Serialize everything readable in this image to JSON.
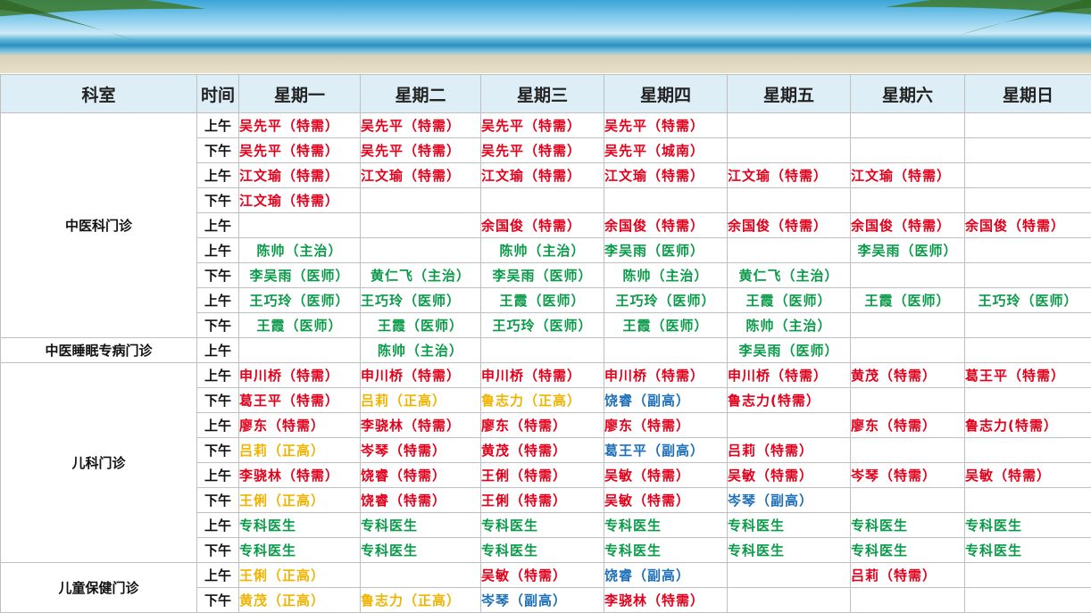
{
  "header": {
    "dept": "科室",
    "time": "时间",
    "days": [
      "星期一",
      "星期二",
      "星期三",
      "星期四",
      "星期五",
      "星期六",
      "星期日"
    ]
  },
  "groups": [
    {
      "dept": "中医科门诊",
      "rows": [
        {
          "time": "上午",
          "cells": [
            {
              "t": "吴先平（特需）",
              "c": "red"
            },
            {
              "t": "吴先平（特需）",
              "c": "red"
            },
            {
              "t": "吴先平（特需）",
              "c": "red"
            },
            {
              "t": "吴先平（特需）",
              "c": "red"
            },
            null,
            null,
            null
          ]
        },
        {
          "time": "下午",
          "cells": [
            {
              "t": "吴先平（特需）",
              "c": "red"
            },
            {
              "t": "吴先平（特需）",
              "c": "red"
            },
            {
              "t": "吴先平（特需）",
              "c": "red"
            },
            {
              "t": "吴先平（城南）",
              "c": "red"
            },
            null,
            null,
            null
          ]
        },
        {
          "time": "上午",
          "cells": [
            {
              "t": "江文瑜（特需）",
              "c": "red"
            },
            {
              "t": "江文瑜（特需）",
              "c": "red"
            },
            {
              "t": "江文瑜（特需）",
              "c": "red"
            },
            {
              "t": "江文瑜（特需）",
              "c": "red"
            },
            {
              "t": "江文瑜（特需）",
              "c": "red"
            },
            {
              "t": "江文瑜（特需）",
              "c": "red"
            },
            null
          ]
        },
        {
          "time": "下午",
          "cells": [
            {
              "t": "江文瑜（特需）",
              "c": "red"
            },
            null,
            null,
            null,
            null,
            null,
            null
          ]
        },
        {
          "time": "上午",
          "cells": [
            null,
            null,
            {
              "t": "余国俊（特需）",
              "c": "red"
            },
            {
              "t": "余国俊（特需）",
              "c": "red"
            },
            {
              "t": "余国俊（特需）",
              "c": "red"
            },
            {
              "t": "余国俊（特需）",
              "c": "red"
            },
            {
              "t": "余国俊（特需）",
              "c": "red"
            }
          ]
        },
        {
          "time": "上午",
          "cells": [
            {
              "t": "陈帅（主治）",
              "c": "green",
              "center": true
            },
            null,
            {
              "t": "陈帅（主治）",
              "c": "green",
              "center": true
            },
            {
              "t": "李吴雨（医师）",
              "c": "green"
            },
            null,
            {
              "t": "李吴雨（医师）",
              "c": "green",
              "center": true
            },
            null
          ]
        },
        {
          "time": "下午",
          "cells": [
            {
              "t": "李吴雨（医师）",
              "c": "green",
              "center": true
            },
            {
              "t": "黄仁飞（主治）",
              "c": "green",
              "center": true
            },
            {
              "t": "李吴雨（医师）",
              "c": "green",
              "center": true
            },
            {
              "t": "陈帅（主治）",
              "c": "green",
              "center": true
            },
            {
              "t": "黄仁飞（主治）",
              "c": "green",
              "center": true
            },
            null,
            null
          ]
        },
        {
          "time": "上午",
          "cells": [
            {
              "t": "王巧玲（医师）",
              "c": "green",
              "center": true
            },
            {
              "t": "王巧玲（医师）",
              "c": "green"
            },
            {
              "t": "王霞（医师）",
              "c": "green",
              "center": true
            },
            {
              "t": "王巧玲（医师）",
              "c": "green",
              "center": true
            },
            {
              "t": "王霞（医师）",
              "c": "green",
              "center": true
            },
            {
              "t": "王霞（医师）",
              "c": "green",
              "center": true
            },
            {
              "t": "王巧玲（医师）",
              "c": "green",
              "center": true
            }
          ]
        },
        {
          "time": "下午",
          "cells": [
            {
              "t": "王霞（医师）",
              "c": "green",
              "center": true
            },
            {
              "t": "王霞（医师）",
              "c": "green",
              "center": true
            },
            {
              "t": "王巧玲（医师）",
              "c": "green",
              "center": true
            },
            {
              "t": "王霞（医师）",
              "c": "green",
              "center": true
            },
            {
              "t": "陈帅（主治）",
              "c": "green",
              "center": true
            },
            null,
            null
          ]
        }
      ]
    },
    {
      "dept": "中医睡眠专病门诊",
      "rows": [
        {
          "time": "上午",
          "cells": [
            null,
            {
              "t": "陈帅（主治）",
              "c": "green",
              "center": true
            },
            null,
            null,
            {
              "t": "李吴雨（医师）",
              "c": "green",
              "center": true
            },
            null,
            null
          ]
        }
      ]
    },
    {
      "dept": "儿科门诊",
      "rows": [
        {
          "time": "上午",
          "cells": [
            {
              "t": "申川桥（特需）",
              "c": "red"
            },
            {
              "t": "申川桥（特需）",
              "c": "red"
            },
            {
              "t": "申川桥（特需）",
              "c": "red"
            },
            {
              "t": "申川桥（特需）",
              "c": "red"
            },
            {
              "t": "申川桥（特需）",
              "c": "red"
            },
            {
              "t": "黄茂（特需）",
              "c": "red"
            },
            {
              "t": "葛王平（特需）",
              "c": "red"
            }
          ]
        },
        {
          "time": "下午",
          "cells": [
            {
              "t": "葛王平（特需）",
              "c": "red"
            },
            {
              "t": "吕莉（正高）",
              "c": "gold"
            },
            {
              "t": "鲁志力（正高）",
              "c": "gold"
            },
            {
              "t": "饶睿（副高）",
              "c": "blue"
            },
            {
              "t": "鲁志力(特需）",
              "c": "red"
            },
            null,
            null
          ]
        },
        {
          "time": "上午",
          "cells": [
            {
              "t": "廖东（特需）",
              "c": "red"
            },
            {
              "t": "李骁林（特需）",
              "c": "red"
            },
            {
              "t": "廖东（特需）",
              "c": "red"
            },
            {
              "t": "廖东（特需）",
              "c": "red"
            },
            null,
            {
              "t": "廖东（特需）",
              "c": "red"
            },
            {
              "t": "鲁志力(特需）",
              "c": "red"
            }
          ]
        },
        {
          "time": "下午",
          "cells": [
            {
              "t": "吕莉（正高）",
              "c": "gold"
            },
            {
              "t": "岑琴（特需）",
              "c": "red"
            },
            {
              "t": "黄茂（特需）",
              "c": "red"
            },
            {
              "t": "葛王平（副高）",
              "c": "blue"
            },
            {
              "t": "吕莉（特需）",
              "c": "red"
            },
            null,
            null
          ]
        },
        {
          "time": "上午",
          "cells": [
            {
              "t": "李骁林（特需）",
              "c": "red"
            },
            {
              "t": "饶睿（特需）",
              "c": "red"
            },
            {
              "t": "王俐（特需）",
              "c": "red"
            },
            {
              "t": "吴敏（特需）",
              "c": "red"
            },
            {
              "t": "吴敏（特需）",
              "c": "red"
            },
            {
              "t": "岑琴（特需）",
              "c": "red"
            },
            {
              "t": "吴敏（特需）",
              "c": "red"
            }
          ]
        },
        {
          "time": "下午",
          "cells": [
            {
              "t": "王俐（正高）",
              "c": "gold"
            },
            {
              "t": "饶睿（特需）",
              "c": "red"
            },
            {
              "t": "王俐（特需）",
              "c": "red"
            },
            {
              "t": "吴敏（特需）",
              "c": "red"
            },
            {
              "t": "岑琴（副高）",
              "c": "blue"
            },
            null,
            null
          ]
        },
        {
          "time": "上午",
          "cells": [
            {
              "t": "专科医生",
              "c": "green"
            },
            {
              "t": "专科医生",
              "c": "green"
            },
            {
              "t": "专科医生",
              "c": "green"
            },
            {
              "t": "专科医生",
              "c": "green"
            },
            {
              "t": "专科医生",
              "c": "green"
            },
            {
              "t": "专科医生",
              "c": "green"
            },
            {
              "t": "专科医生",
              "c": "green"
            }
          ]
        },
        {
          "time": "下午",
          "cells": [
            {
              "t": "专科医生",
              "c": "green"
            },
            {
              "t": "专科医生",
              "c": "green"
            },
            {
              "t": "专科医生",
              "c": "green"
            },
            {
              "t": "专科医生",
              "c": "green"
            },
            {
              "t": "专科医生",
              "c": "green"
            },
            {
              "t": "专科医生",
              "c": "green"
            },
            {
              "t": "专科医生",
              "c": "green"
            }
          ]
        }
      ]
    },
    {
      "dept": "儿童保健门诊",
      "rows": [
        {
          "time": "上午",
          "cells": [
            {
              "t": "王俐（正高）",
              "c": "gold"
            },
            null,
            {
              "t": "吴敏（特需）",
              "c": "red"
            },
            {
              "t": "饶睿（副高）",
              "c": "blue"
            },
            null,
            {
              "t": "吕莉（特需）",
              "c": "red"
            },
            null
          ]
        },
        {
          "time": "下午",
          "cells": [
            {
              "t": "黄茂（正高）",
              "c": "gold"
            },
            {
              "t": "鲁志力（正高）",
              "c": "gold"
            },
            {
              "t": "岑琴（副高）",
              "c": "blue"
            },
            {
              "t": "李骁林（特需）",
              "c": "red"
            },
            null,
            null,
            null
          ]
        }
      ]
    }
  ]
}
